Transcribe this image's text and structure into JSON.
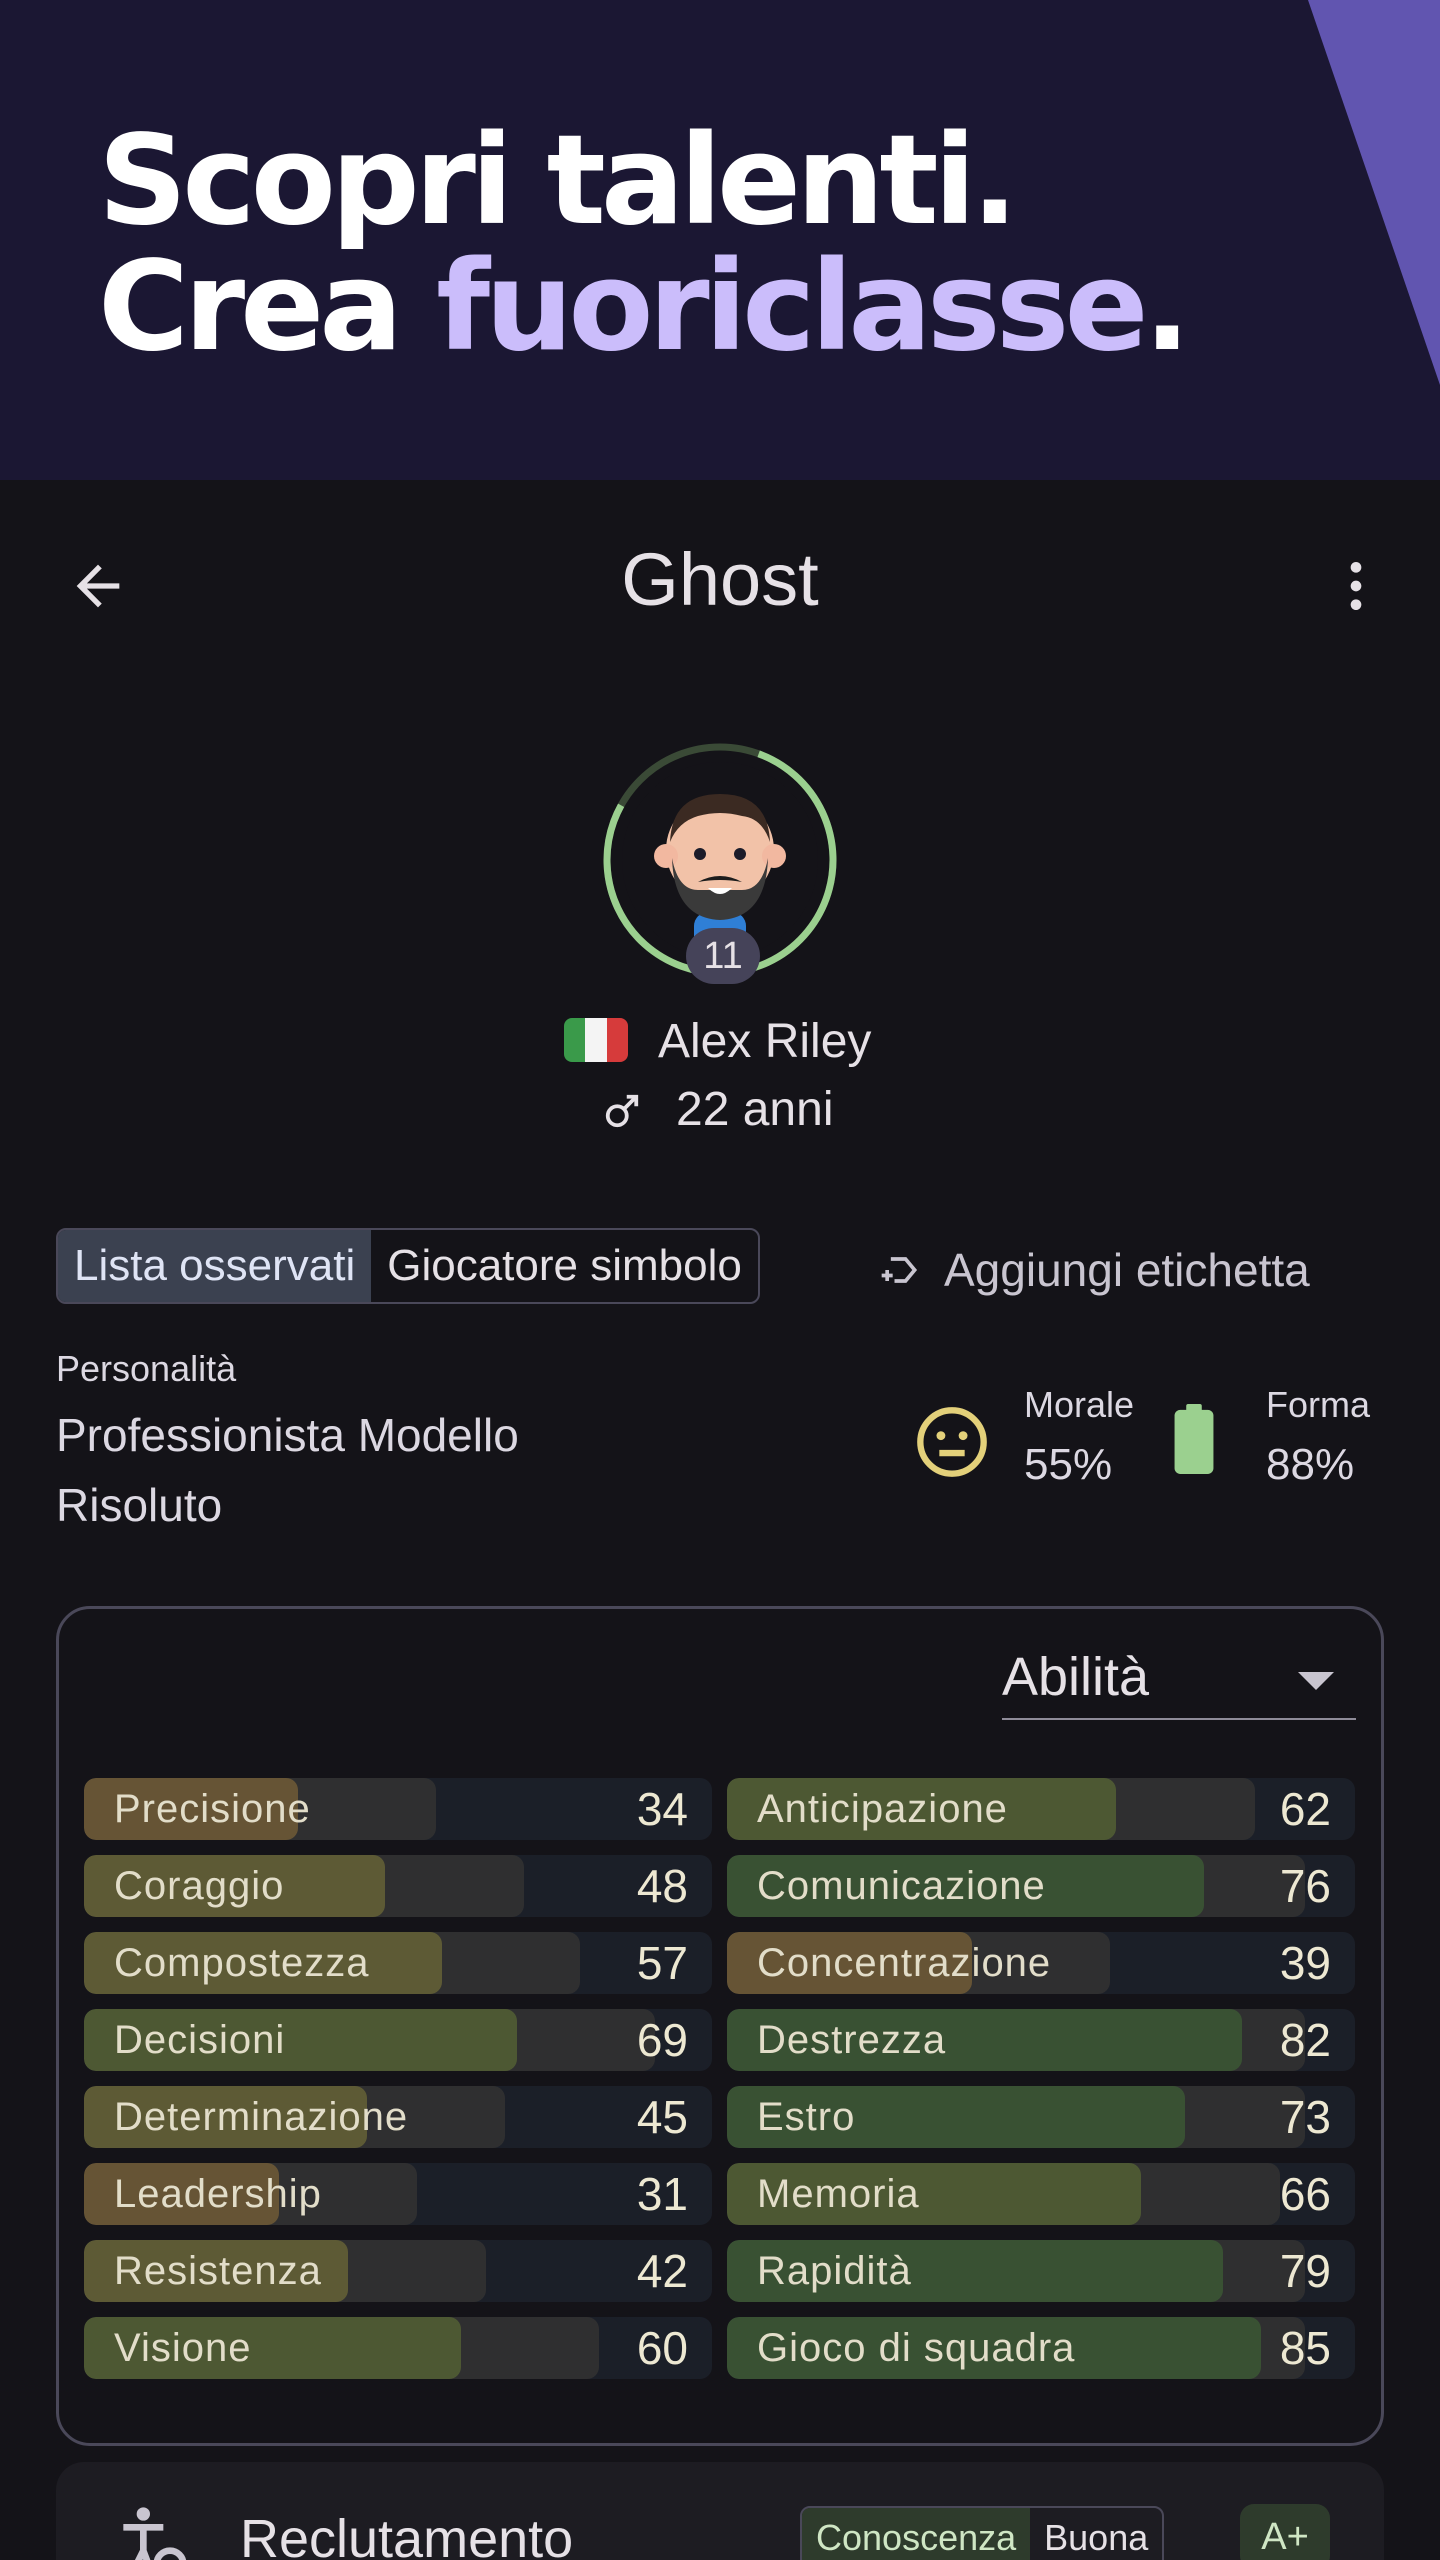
{
  "banner": {
    "line1": "Scopri talenti.",
    "line2_prefix": "Crea ",
    "line2_accent": "fuoriclasse",
    "line2_suffix": "."
  },
  "appbar": {
    "title": "Ghost",
    "back_icon": "arrow-back-icon",
    "more_icon": "more-vert-icon"
  },
  "player": {
    "name": "Alex Riley",
    "shirt_number": "11",
    "age": "22 anni",
    "nationality_flag": "italy-flag",
    "gender_icon": "male-icon",
    "ring_color": "#9bd08f"
  },
  "tags": {
    "items": [
      "Lista osservati",
      "Giocatore simbolo"
    ],
    "add_label": "Aggiungi etichetta"
  },
  "personality": {
    "label": "Personalità",
    "value": "Professionista Modello Risoluto"
  },
  "morale": {
    "label": "Morale",
    "value": "55%",
    "icon": "neutral-face-icon"
  },
  "fitness": {
    "label": "Forma",
    "value": "88%",
    "icon": "battery-icon"
  },
  "attributes": {
    "selector": "Abilità",
    "left": [
      {
        "name": "Precisione",
        "value": 34
      },
      {
        "name": "Coraggio",
        "value": 48
      },
      {
        "name": "Compostezza",
        "value": 57
      },
      {
        "name": "Decisioni",
        "value": 69
      },
      {
        "name": "Determinazione",
        "value": 45
      },
      {
        "name": "Leadership",
        "value": 31
      },
      {
        "name": "Resistenza",
        "value": 42
      },
      {
        "name": "Visione",
        "value": 60
      }
    ],
    "right": [
      {
        "name": "Anticipazione",
        "value": 62
      },
      {
        "name": "Comunicazione",
        "value": 76
      },
      {
        "name": "Concentrazione",
        "value": 39
      },
      {
        "name": "Destrezza",
        "value": 82
      },
      {
        "name": "Estro",
        "value": 73
      },
      {
        "name": "Memoria",
        "value": 66
      },
      {
        "name": "Rapidità",
        "value": 79
      },
      {
        "name": "Gioco di squadra",
        "value": 85
      }
    ]
  },
  "recruitment": {
    "title": "Reclutamento",
    "knowledge_label": "Conoscenza",
    "knowledge_value": "Buona",
    "grade": "A+"
  }
}
